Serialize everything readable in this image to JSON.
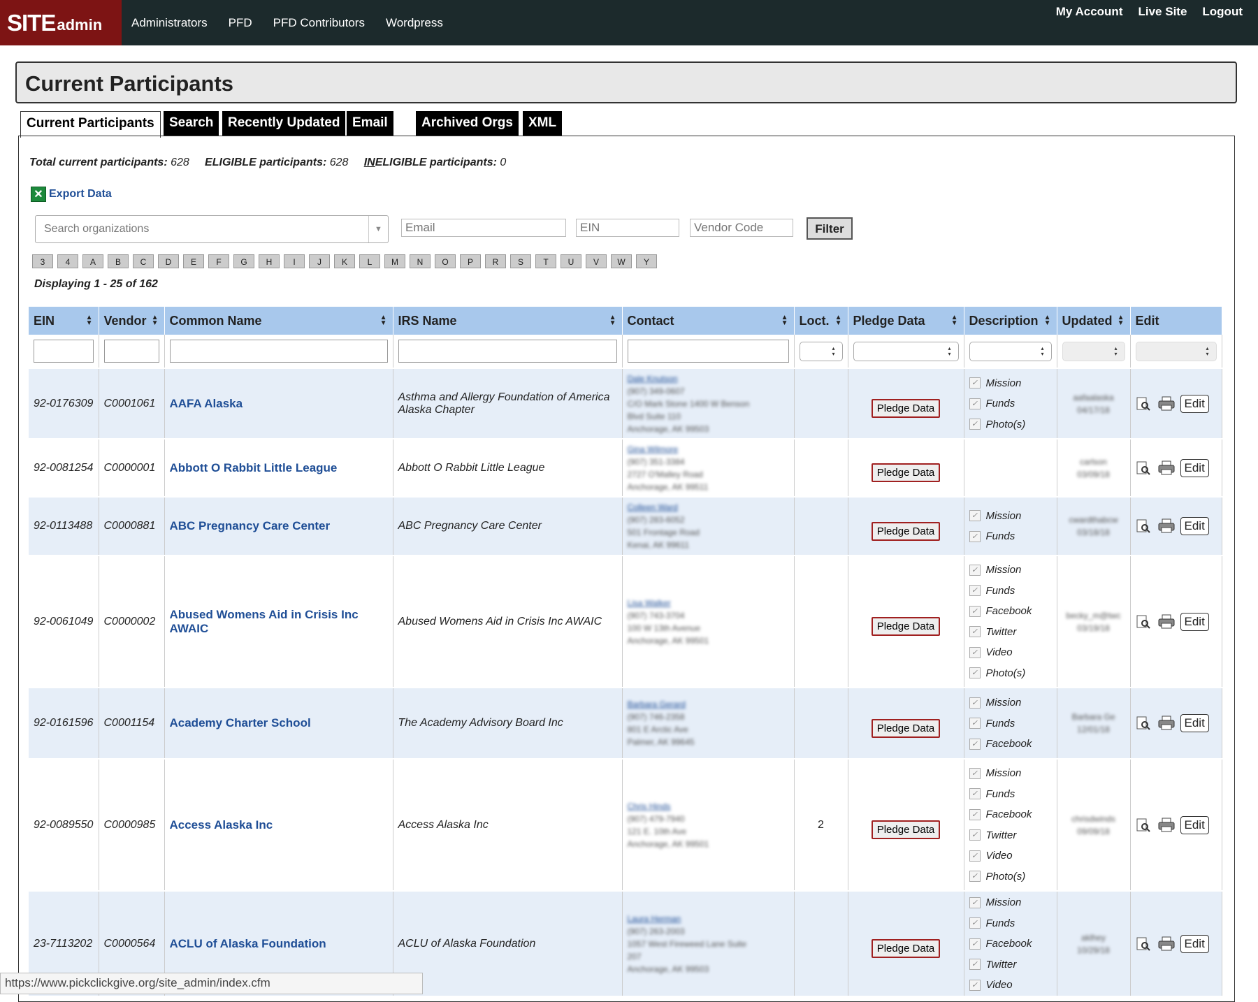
{
  "header": {
    "logo_main": "SITE",
    "logo_sub": "admin",
    "nav": [
      "Administrators",
      "PFD",
      "PFD Contributors",
      "Wordpress"
    ],
    "right_nav": [
      "My Account",
      "Live Site",
      "Logout"
    ]
  },
  "page_title": "Current Participants",
  "tabs": [
    "Current Participants",
    "Search",
    "Recently Updated",
    "Email",
    "Archived Orgs",
    "XML"
  ],
  "stats": {
    "total_label": "Total current participants:",
    "total_value": "628",
    "eligible_label": "ELIGIBLE participants:",
    "eligible_value": "628",
    "ineligible_label_ul": "IN",
    "ineligible_label_rest": "ELIGIBLE participants:",
    "ineligible_value": "0"
  },
  "export_label": "Export Data",
  "filters": {
    "org_placeholder": "Search organizations",
    "email_placeholder": "Email",
    "ein_placeholder": "EIN",
    "vendor_placeholder": "Vendor Code",
    "filter_label": "Filter"
  },
  "letters": [
    "3",
    "4",
    "A",
    "B",
    "C",
    "D",
    "E",
    "F",
    "G",
    "H",
    "I",
    "J",
    "K",
    "L",
    "M",
    "N",
    "O",
    "P",
    "R",
    "S",
    "T",
    "U",
    "V",
    "W",
    "Y"
  ],
  "displaying": "Displaying 1 - 25 of 162",
  "columns": [
    "EIN",
    "Vendor",
    "Common Name",
    "IRS Name",
    "Contact",
    "Loct.",
    "Pledge Data",
    "Description",
    "Updated",
    "Edit"
  ],
  "pledge_label": "Pledge Data",
  "edit_label": "Edit",
  "rows": [
    {
      "ein": "92-0176309",
      "vendor": "C0001061",
      "common": "AAFA Alaska",
      "irs": "Asthma and Allergy Foundation of America Alaska Chapter",
      "contact": [
        "Dale Knutson",
        "(907) 349-0607",
        "C/O Mark Stone 1400 W Benson",
        "Blvd Suite 110",
        "Anchorage, AK 99503"
      ],
      "loct": "",
      "desc": [
        "Mission",
        "Funds",
        "Photo(s)"
      ],
      "updated": [
        "aafaalaska",
        "04/17/18"
      ]
    },
    {
      "ein": "92-0081254",
      "vendor": "C0000001",
      "common": "Abbott O Rabbit Little League",
      "irs": "Abbott O Rabbit Little League",
      "contact": [
        "Gina Wilmore",
        "(907) 351-3384",
        "2727 O'Malley Road",
        "Anchorage, AK 99511"
      ],
      "loct": "",
      "desc": [],
      "updated": [
        "carlson",
        "03/09/18"
      ]
    },
    {
      "ein": "92-0113488",
      "vendor": "C0000881",
      "common": "ABC Pregnancy Care Center",
      "irs": "ABC Pregnancy Care Center",
      "contact": [
        "Colleen Ward",
        "(907) 283-6052",
        "501 Frontage Road",
        "Kenai, AK 99611"
      ],
      "loct": "",
      "desc": [
        "Mission",
        "Funds"
      ],
      "updated": [
        "cwardthabcw",
        "03/18/18"
      ]
    },
    {
      "ein": "92-0061049",
      "vendor": "C0000002",
      "common": "Abused Womens Aid in Crisis Inc AWAIC",
      "irs": "Abused Womens Aid in Crisis Inc AWAIC",
      "contact": [
        "Lisa Walker",
        "(907) 743-3704",
        "100 W 13th Avenue",
        "Anchorage, AK 99501"
      ],
      "loct": "",
      "desc": [
        "Mission",
        "Funds",
        "Facebook",
        "Twitter",
        "Video",
        "Photo(s)"
      ],
      "updated": [
        "becky_m@twc",
        "03/19/18"
      ]
    },
    {
      "ein": "92-0161596",
      "vendor": "C0001154",
      "common": "Academy Charter School",
      "irs": "The Academy Advisory Board Inc",
      "contact": [
        "Barbara Gerard",
        "(907) 746-2358",
        "801 E Arctic Ave",
        "Palmer, AK 99645"
      ],
      "loct": "",
      "desc": [
        "Mission",
        "Funds",
        "Facebook"
      ],
      "updated": [
        "Barbara Ge",
        "12/01/18"
      ]
    },
    {
      "ein": "92-0089550",
      "vendor": "C0000985",
      "common": "Access Alaska Inc",
      "irs": "Access Alaska Inc",
      "contact": [
        "Chris Hinds",
        "(907) 479-7940",
        "121 E. 10th Ave",
        "Anchorage, AK 99501"
      ],
      "loct": "2",
      "desc": [
        "Mission",
        "Funds",
        "Facebook",
        "Twitter",
        "Video",
        "Photo(s)"
      ],
      "updated": [
        "chrisdwinds",
        "09/09/18"
      ]
    },
    {
      "ein": "23-7113202",
      "vendor": "C0000564",
      "common": "ACLU of Alaska Foundation",
      "irs": "ACLU of Alaska Foundation",
      "contact": [
        "Laura Herman",
        "(907) 263-2003",
        "1057 West Fireweed Lane Suite",
        "207",
        "Anchorage, AK 99503"
      ],
      "loct": "",
      "desc": [
        "Mission",
        "Funds",
        "Facebook",
        "Twitter",
        "Video"
      ],
      "updated": [
        "aklhey",
        "10/29/18"
      ]
    }
  ],
  "status_url": "https://www.pickclickgive.org/site_admin/index.cfm",
  "colors": {
    "topbar": "#1c2a2c",
    "logo_bg": "#7d1414",
    "header_blue": "#a8c8ec",
    "row_alt": "#e6eef8",
    "link": "#1f4e96"
  }
}
